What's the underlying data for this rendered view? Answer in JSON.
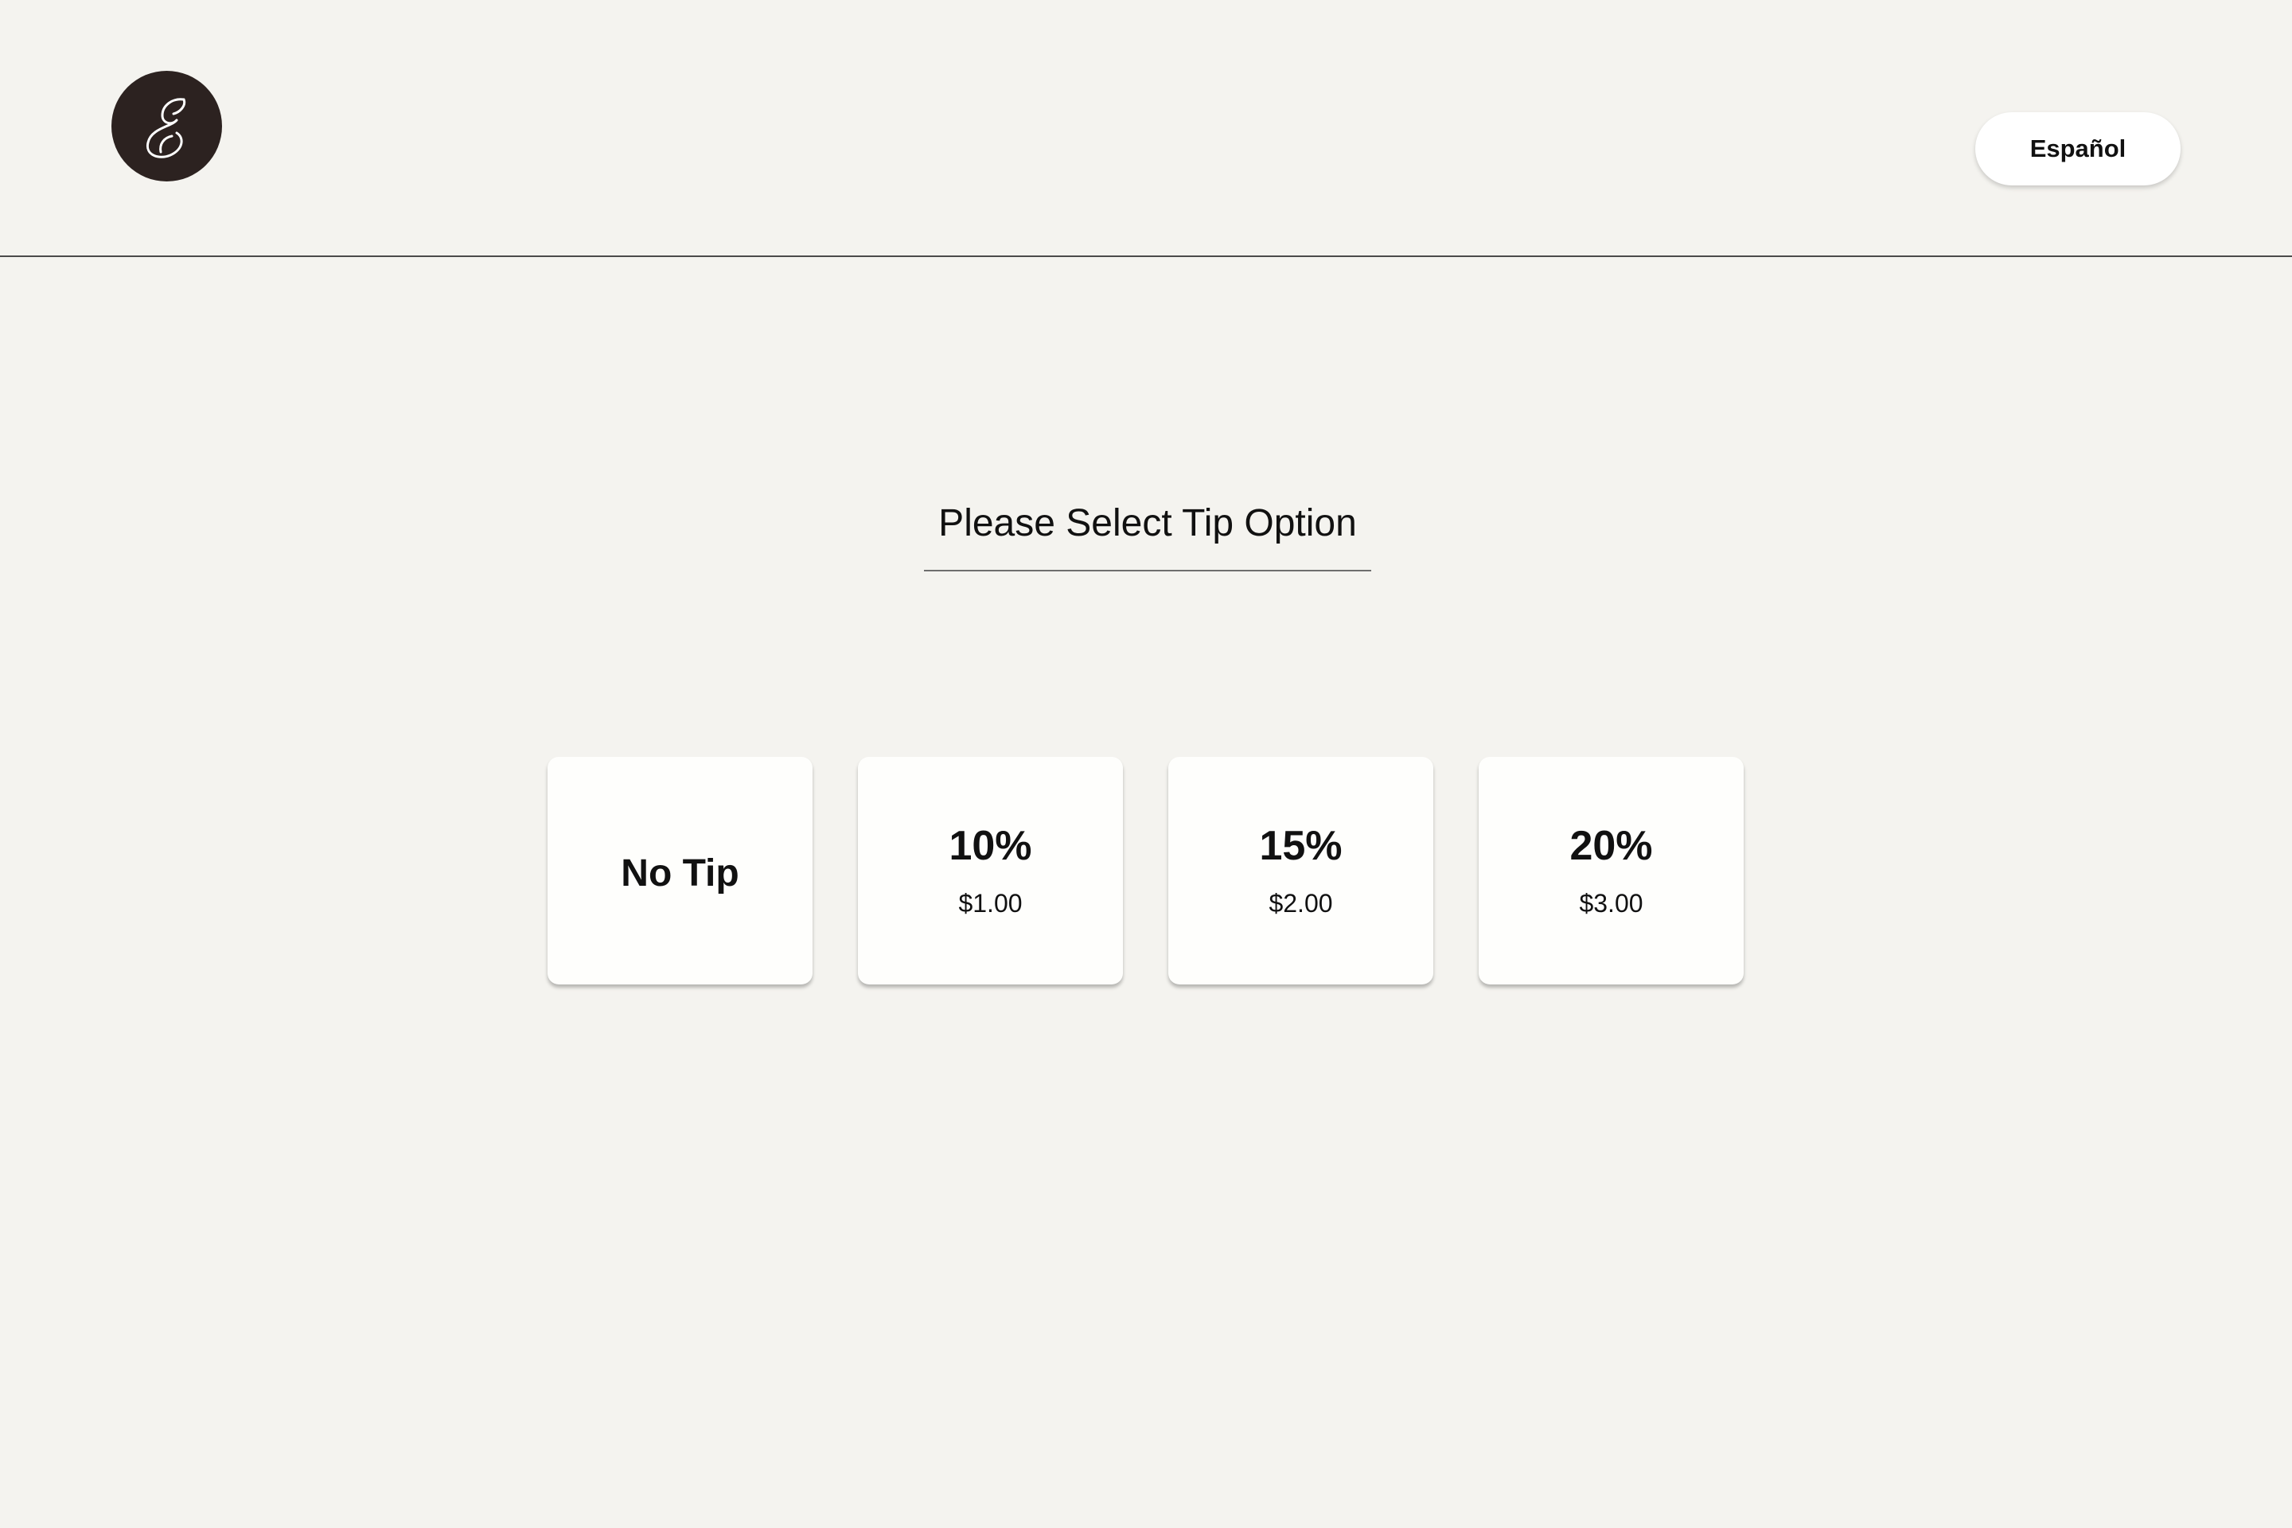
{
  "header": {
    "logo_icon": "script-e-logo-icon",
    "language_button_label": "Español"
  },
  "main": {
    "title": "Please Select Tip Option",
    "tip_options": [
      {
        "label": "No Tip"
      },
      {
        "percent": "10%",
        "amount": "$1.00"
      },
      {
        "percent": "15%",
        "amount": "$2.00"
      },
      {
        "percent": "20%",
        "amount": "$3.00"
      }
    ]
  },
  "colors": {
    "background": "#f4f3ef",
    "logo_background": "#2c2220",
    "card_background": "#fefefc",
    "text": "#111111"
  }
}
